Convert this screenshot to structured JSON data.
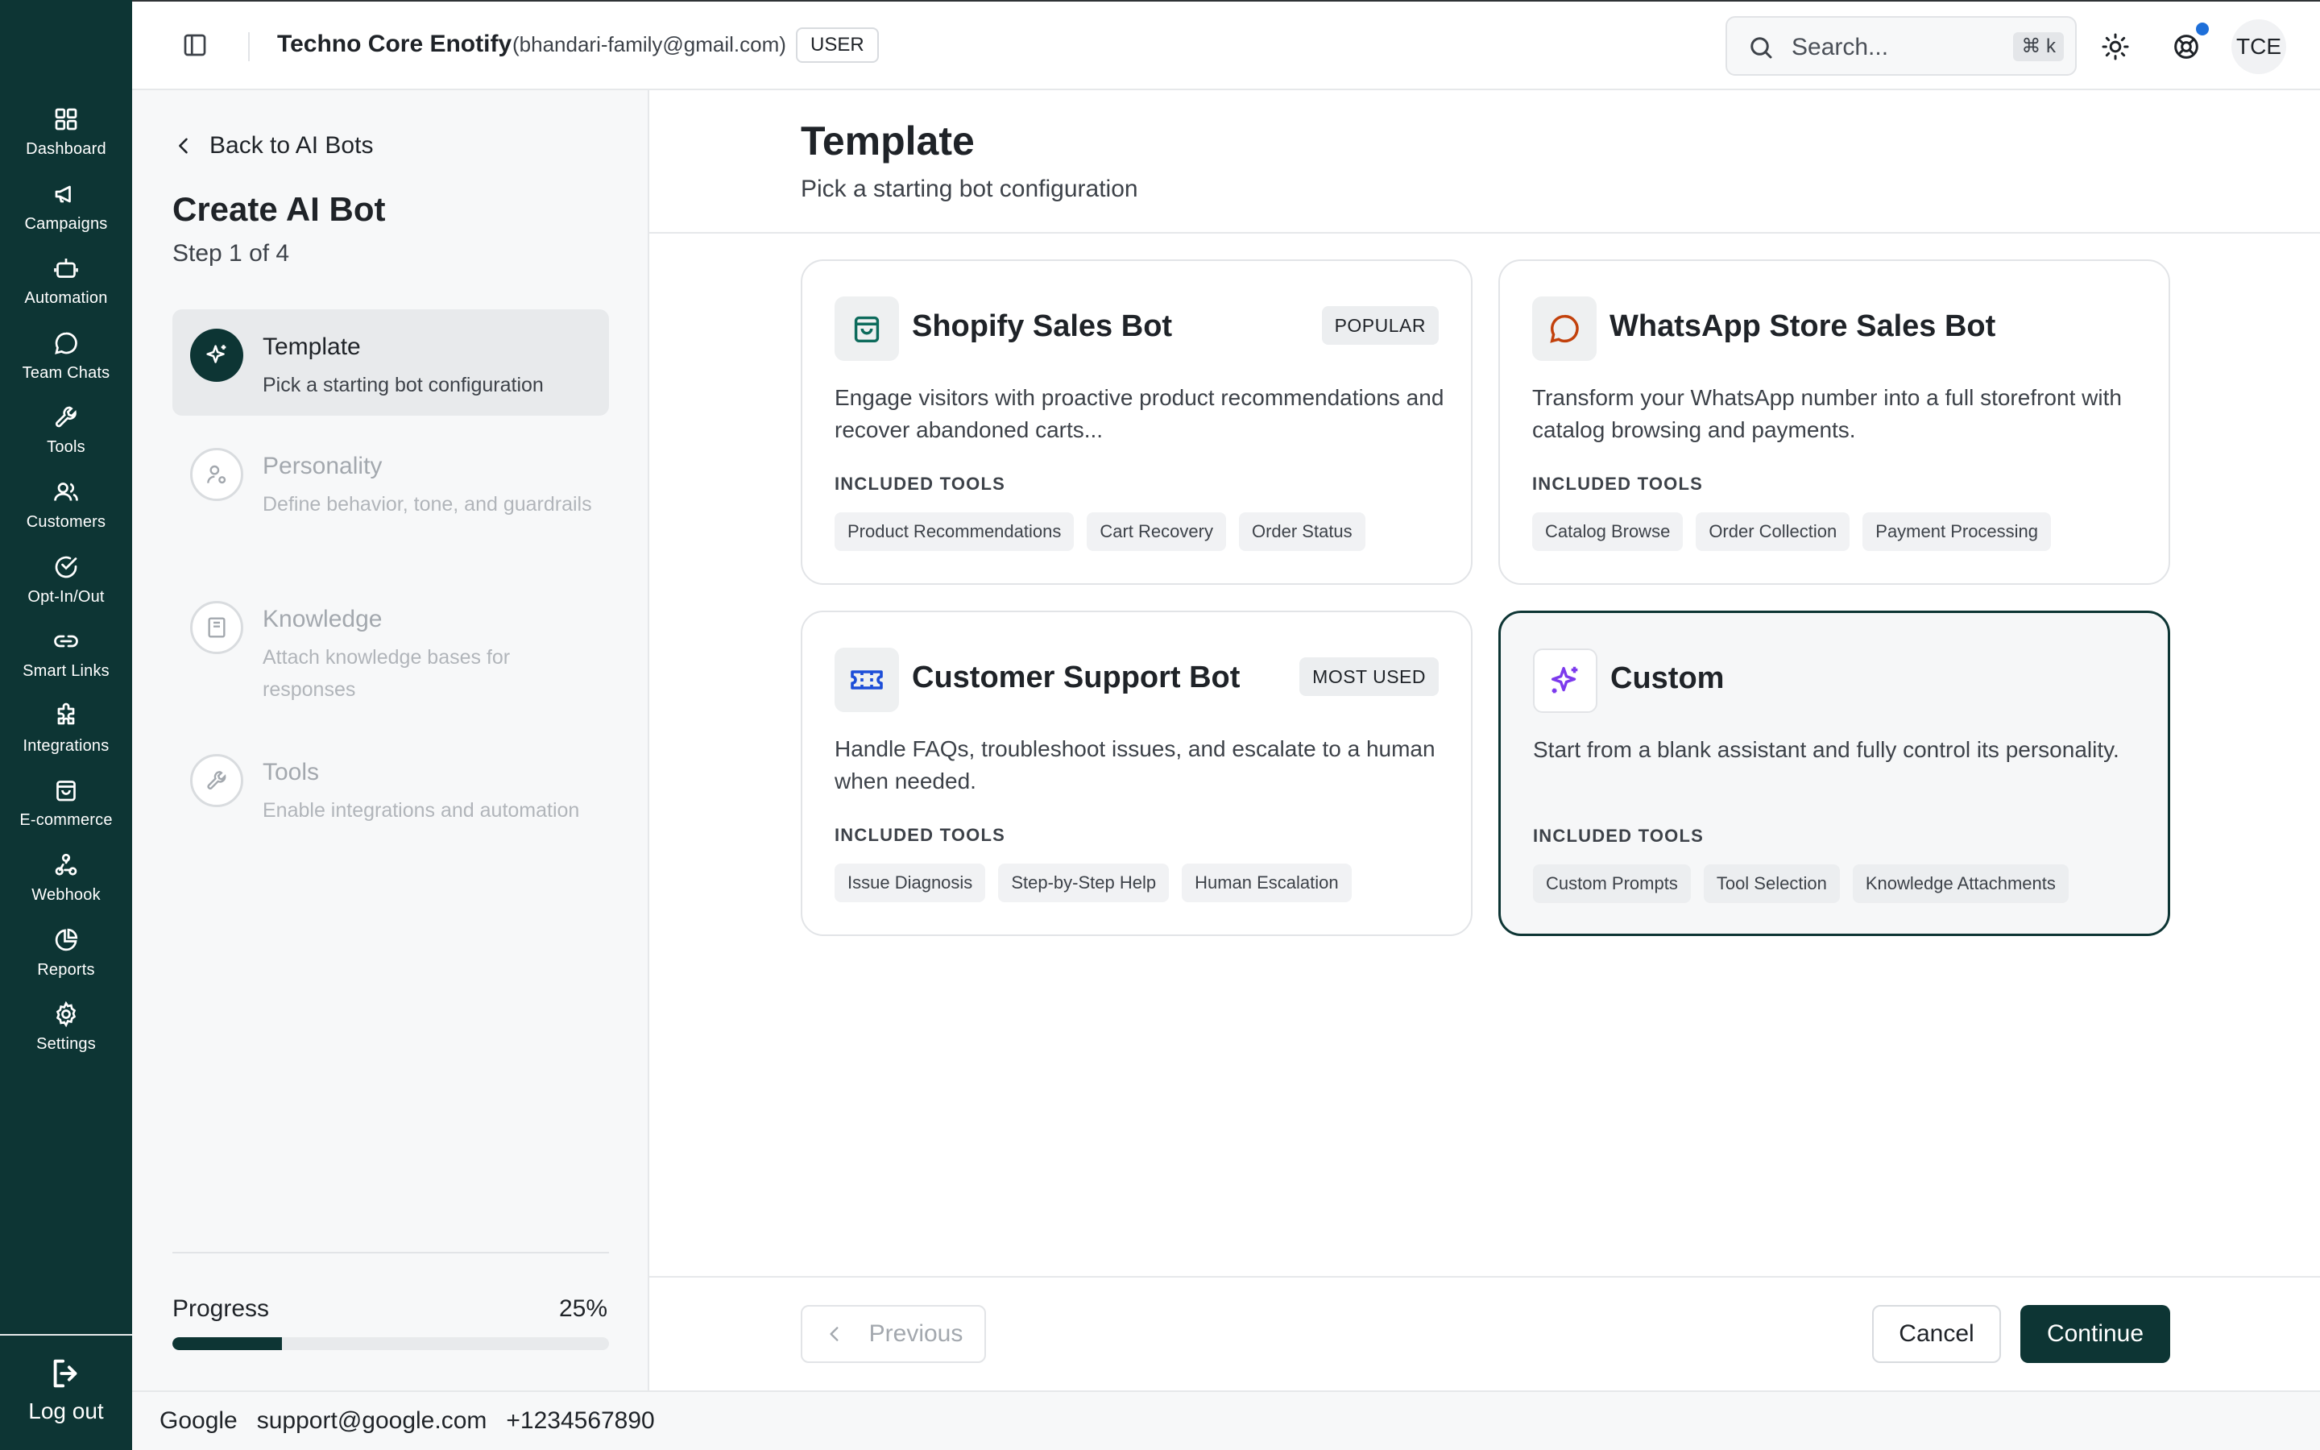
{
  "nav": {
    "items": [
      {
        "label": "Dashboard",
        "icon": "grid-icon"
      },
      {
        "label": "Campaigns",
        "icon": "megaphone-icon"
      },
      {
        "label": "Automation",
        "icon": "bot-icon"
      },
      {
        "label": "Team Chats",
        "icon": "chat-bubble-icon"
      },
      {
        "label": "Tools",
        "icon": "wrench-icon"
      },
      {
        "label": "Customers",
        "icon": "users-icon"
      },
      {
        "label": "Opt-In/Out",
        "icon": "check-circle-icon"
      },
      {
        "label": "Smart Links",
        "icon": "link-icon"
      },
      {
        "label": "Integrations",
        "icon": "puzzle-icon"
      },
      {
        "label": "E-commerce",
        "icon": "shopping-bag-icon"
      },
      {
        "label": "Webhook",
        "icon": "webhook-icon"
      },
      {
        "label": "Reports",
        "icon": "pie-chart-icon"
      },
      {
        "label": "Settings",
        "icon": "gear-icon"
      }
    ],
    "logout_label": "Log out"
  },
  "topbar": {
    "org_name": "Techno Core Enotify",
    "email": "(bhandari-family@gmail.com)",
    "role": "USER",
    "search_placeholder": "Search...",
    "search_shortcut": "⌘ k",
    "avatar_initials": "TCE"
  },
  "steps_panel": {
    "back_label": "Back to AI Bots",
    "title": "Create AI Bot",
    "subtitle": "Step 1 of 4",
    "steps": [
      {
        "title": "Template",
        "desc": "Pick a starting bot configuration",
        "active": true
      },
      {
        "title": "Personality",
        "desc": "Define behavior, tone, and guardrails",
        "active": false
      },
      {
        "title": "Knowledge",
        "desc": "Attach knowledge bases for responses",
        "active": false
      },
      {
        "title": "Tools",
        "desc": "Enable integrations and automation",
        "active": false
      }
    ],
    "progress_label": "Progress",
    "progress_text": "25%",
    "progress_value": 0.25
  },
  "main": {
    "title": "Template",
    "subtitle": "Pick a starting bot configuration",
    "tools_label": "INCLUDED TOOLS",
    "templates": [
      {
        "title": "Shopify Sales Bot",
        "badge": "POPULAR",
        "desc": "Engage visitors with proactive product recommendations and recover abandoned carts...",
        "tools": [
          "Product Recommendations",
          "Cart Recovery",
          "Order Status"
        ],
        "icon": "shopping-bag-icon",
        "icon_color": "#0d6b5c"
      },
      {
        "title": "WhatsApp Store Sales Bot",
        "badge": "",
        "desc": "Transform your WhatsApp number into a full storefront with catalog browsing and payments.",
        "tools": [
          "Catalog Browse",
          "Order Collection",
          "Payment Processing"
        ],
        "icon": "chat-bubble-icon",
        "icon_color": "#c2410c"
      },
      {
        "title": "Customer Support Bot",
        "badge": "MOST USED",
        "desc": "Handle FAQs, troubleshoot issues, and escalate to a human when needed.",
        "tools": [
          "Issue Diagnosis",
          "Step-by-Step Help",
          "Human Escalation"
        ],
        "icon": "ticket-icon",
        "icon_color": "#1d4ed8"
      },
      {
        "title": "Custom",
        "badge": "",
        "desc": "Start from a blank assistant and fully control its personality.",
        "tools": [
          "Custom Prompts",
          "Tool Selection",
          "Knowledge Attachments"
        ],
        "icon": "sparkles-icon",
        "icon_color": "#7c3aed",
        "selected": true
      }
    ],
    "previous_label": "Previous",
    "cancel_label": "Cancel",
    "continue_label": "Continue"
  },
  "footer": {
    "company": "Google",
    "email": "support@google.com",
    "phone": "+1234567890"
  },
  "colors": {
    "brand": "#0d3534",
    "notification": "#1e6fd9"
  }
}
